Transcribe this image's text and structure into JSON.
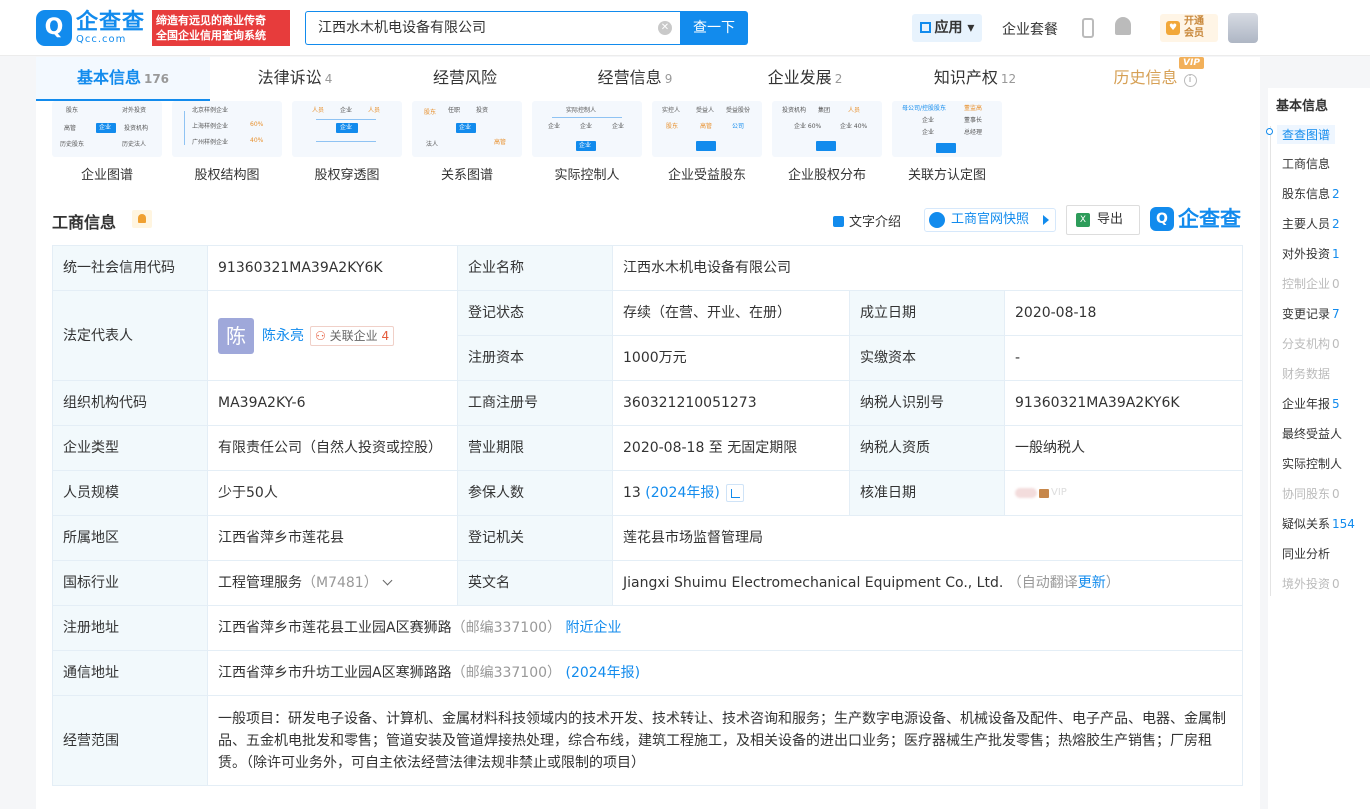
{
  "brand": {
    "mark": "Q",
    "name": "企查查",
    "sub": "Qcc.com",
    "slogan_1": "缔造有远见的商业传奇",
    "slogan_2": "全国企业信用查询系统"
  },
  "search": {
    "value": "江西水木机电设备有限公司",
    "button": "查一下"
  },
  "topnav": {
    "app": "应用",
    "package": "企业套餐",
    "vip_1": "开通",
    "vip_2": "会员"
  },
  "tabs": [
    {
      "label": "基本信息",
      "count": "176"
    },
    {
      "label": "法律诉讼",
      "count": "4"
    },
    {
      "label": "经营风险",
      "count": ""
    },
    {
      "label": "经营信息",
      "count": "9"
    },
    {
      "label": "企业发展",
      "count": "2"
    },
    {
      "label": "知识产权",
      "count": "12"
    },
    {
      "label": "历史信息",
      "count": "",
      "badge": "VIP"
    }
  ],
  "graphs": [
    {
      "label": "企业图谱",
      "t": [
        "股东",
        "对外投资",
        "高管",
        "企业",
        "投资机构",
        "历史股东",
        "历史法人"
      ]
    },
    {
      "label": "股权结构图",
      "t": [
        "北京样例企业",
        "上海样例企业",
        "60%",
        "广州样例企业",
        "40%"
      ]
    },
    {
      "label": "股权穿透图",
      "t": [
        "人员",
        "企业",
        "人员",
        "企业"
      ]
    },
    {
      "label": "关系图谱",
      "t": [
        "股东",
        "任职",
        "投资",
        "企业",
        "法人",
        "高管"
      ]
    },
    {
      "label": "实际控制人",
      "t": [
        "实际控制人",
        "企业",
        "企业",
        "企业",
        "企业"
      ]
    },
    {
      "label": "企业受益股东",
      "t": [
        "实控人",
        "受益人",
        "受益股份",
        "股东",
        "高管",
        "公司"
      ]
    },
    {
      "label": "企业股权分布",
      "t": [
        "投资机构",
        "集团",
        "人员",
        "企业 60%",
        "企业 40%"
      ]
    },
    {
      "label": "关联方认定图",
      "t": [
        "母公司/控股股东",
        "董监高",
        "企业",
        "董事长",
        "企业",
        "总经理"
      ]
    }
  ],
  "section": {
    "title": "工商信息",
    "text_intro": "文字介绍",
    "snapshot": "工商官网快照",
    "export": "导出",
    "watermark": "企查查"
  },
  "info": {
    "credit_code_k": "统一社会信用代码",
    "credit_code": "91360321MA39A2KY6K",
    "name_k": "企业名称",
    "name": "江西水木机电设备有限公司",
    "rep_k": "法定代表人",
    "rep_avatar": "陈",
    "rep_name": "陈永亮",
    "rep_rel": "关联企业",
    "rep_rel_n": "4",
    "status_k": "登记状态",
    "status": "存续（在营、开业、在册）",
    "founded_k": "成立日期",
    "founded": "2020-08-18",
    "capital_k": "注册资本",
    "capital": "1000万元",
    "paid_k": "实缴资本",
    "paid": "-",
    "org_k": "组织机构代码",
    "org": "MA39A2KY-6",
    "reg_no_k": "工商注册号",
    "reg_no": "360321210051273",
    "tax_k": "纳税人识别号",
    "tax": "91360321MA39A2KY6K",
    "type_k": "企业类型",
    "type": "有限责任公司（自然人投资或控股）",
    "term_k": "营业期限",
    "term": "2020-08-18 至 无固定期限",
    "taxq_k": "纳税人资质",
    "taxq": "一般纳税人",
    "size_k": "人员规模",
    "size": "少于50人",
    "insured_k": "参保人数",
    "insured": "13",
    "insured_note": "(2024年报)",
    "approve_k": "核准日期",
    "approve_vip": "VIP",
    "region_k": "所属地区",
    "region": "江西省萍乡市莲花县",
    "authority_k": "登记机关",
    "authority": "莲花县市场监督管理局",
    "industry_k": "国标行业",
    "industry": "工程管理服务",
    "industry_code": "（M7481）",
    "en_k": "英文名",
    "en": "Jiangxi Shuimu Electromechanical Equipment Co., Ltd.",
    "en_note": "（自动翻译",
    "en_update": "更新",
    "en_close": "）",
    "addr_k": "注册地址",
    "addr": "江西省萍乡市莲花县工业园A区赛狮路",
    "addr_zip": "（邮编337100）",
    "addr_link": "附近企业",
    "mail_k": "通信地址",
    "mail": "江西省萍乡市升坊工业园A区寒狮路路",
    "mail_zip": "（邮编337100）",
    "mail_note": "(2024年报)",
    "scope_k": "经营范围",
    "scope": "一般项目：研发电子设备、计算机、金属材料科技领域内的技术开发、技术转让、技术咨询和服务；生产数字电源设备、机械设备及配件、电子产品、电器、金属制品、五金机电批发和零售；管道安装及管道焊接热处理，综合布线，建筑工程施工，及相关设备的进出口业务；医疗器械生产批发零售；热熔胶生产销售；厂房租赁。（除许可业务外，可自主依法经营法律法规非禁止或限制的项目）"
  },
  "sidebar": {
    "title": "基本信息",
    "items": [
      {
        "label": "查查图谱",
        "count": ""
      },
      {
        "label": "工商信息",
        "count": ""
      },
      {
        "label": "股东信息",
        "count": "2"
      },
      {
        "label": "主要人员",
        "count": "2"
      },
      {
        "label": "对外投资",
        "count": "1"
      },
      {
        "label": "控制企业",
        "count": "0"
      },
      {
        "label": "变更记录",
        "count": "7"
      },
      {
        "label": "分支机构",
        "count": "0"
      },
      {
        "label": "财务数据",
        "count": ""
      },
      {
        "label": "企业年报",
        "count": "5"
      },
      {
        "label": "最终受益人",
        "count": ""
      },
      {
        "label": "实际控制人",
        "count": ""
      },
      {
        "label": "协同股东",
        "count": "0"
      },
      {
        "label": "疑似关系",
        "count": "154"
      },
      {
        "label": "同业分析",
        "count": ""
      },
      {
        "label": "境外投资",
        "count": "0"
      }
    ]
  }
}
